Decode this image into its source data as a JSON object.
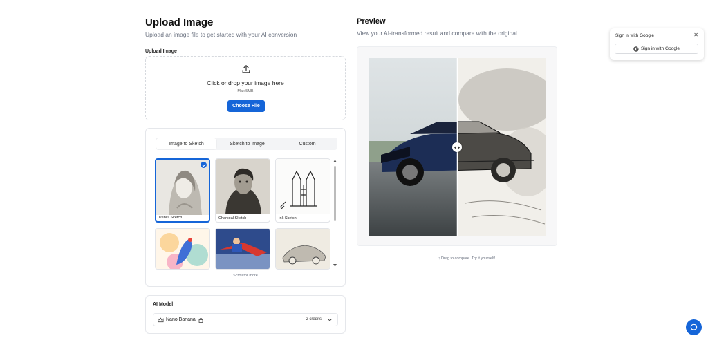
{
  "upload": {
    "title": "Upload Image",
    "subtitle": "Upload an image file to get started with your AI conversion",
    "section_label": "Upload Image",
    "drop_text": "Click or drop your image here",
    "max_text": "Max 5MB",
    "button_label": "Choose File"
  },
  "styles": {
    "tabs": [
      "Image to Sketch",
      "Sketch to Image",
      "Custom"
    ],
    "active_tab": "Image to Sketch",
    "items": [
      {
        "label": "Pencil Sketch",
        "selected": true
      },
      {
        "label": "Charcoal Sketch",
        "selected": false
      },
      {
        "label": "Ink Sketch",
        "selected": false
      },
      {
        "label": "",
        "selected": false
      },
      {
        "label": "",
        "selected": false
      },
      {
        "label": "",
        "selected": false
      }
    ],
    "scroll_hint": "Scroll for more"
  },
  "model": {
    "title": "AI Model",
    "name": "Nano Banana",
    "credits": "2 credits"
  },
  "preview": {
    "title": "Preview",
    "subtitle": "View your AI-transformed result and compare with the original",
    "hint": "↑ Drag to compare. Try it yourself!",
    "split_fraction": 0.5
  },
  "google": {
    "title": "Sign in with Google",
    "button_label": "Sign in with Google"
  },
  "colors": {
    "accent": "#1565d8"
  },
  "icons": [
    "upload-icon",
    "check-icon",
    "crown-icon",
    "lock-icon",
    "chevron-down-icon",
    "close-icon",
    "google-icon",
    "chat-icon",
    "compare-handle-icon"
  ]
}
